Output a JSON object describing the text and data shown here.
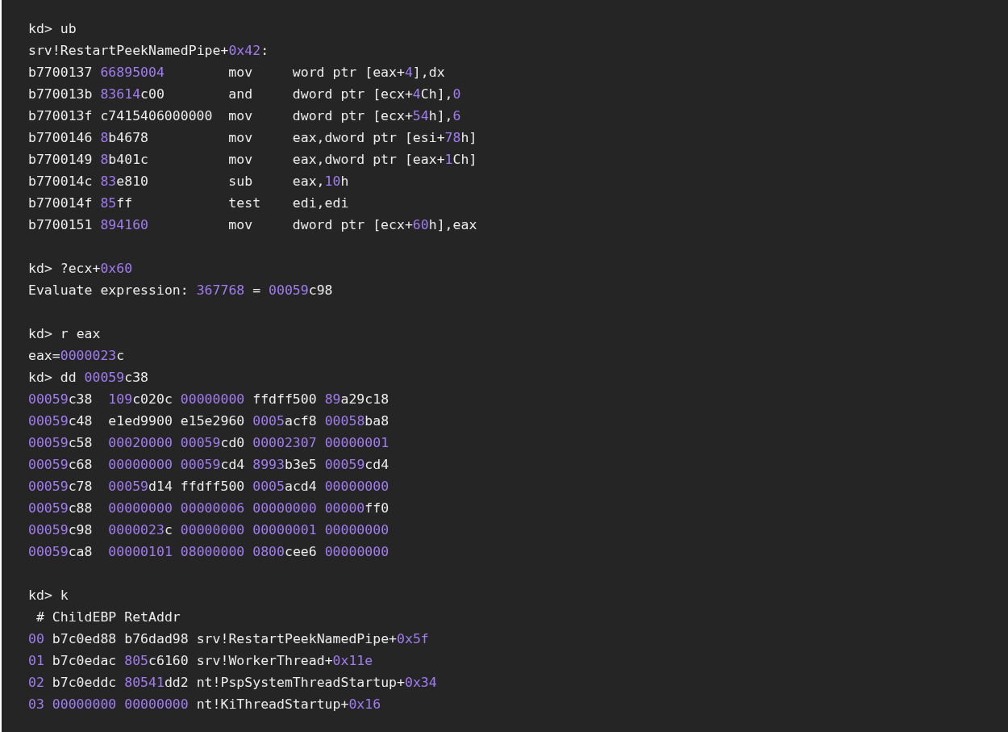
{
  "code_blocks": [
    {
      "lines": [
        "kd> ub",
        "srv!RestartPeekNamedPipe+0x42:"
      ],
      "disassembly": [
        {
          "address": "b7700137",
          "bytes": "66895004",
          "mnemonic": "mov",
          "operands": "word ptr [eax+4],dx"
        },
        {
          "address": "b770013b",
          "bytes": "83614c00",
          "mnemonic": "and",
          "operands": "dword ptr [ecx+4Ch],0"
        },
        {
          "address": "b770013f",
          "bytes": "c7415406000000",
          "mnemonic": "mov",
          "operands": "dword ptr [ecx+54h],6"
        },
        {
          "address": "b7700146",
          "bytes": "8b4678",
          "mnemonic": "mov",
          "operands": "eax,dword ptr [esi+78h]"
        },
        {
          "address": "b7700149",
          "bytes": "8b401c",
          "mnemonic": "mov",
          "operands": "eax,dword ptr [eax+1Ch]"
        },
        {
          "address": "b770014c",
          "bytes": "83e810",
          "mnemonic": "sub",
          "operands": "eax,10h"
        },
        {
          "address": "b770014f",
          "bytes": "85ff",
          "mnemonic": "test",
          "operands": "edi,edi"
        },
        {
          "address": "b7700151",
          "bytes": "894160",
          "mnemonic": "mov",
          "operands": "dword ptr [ecx+60h],eax"
        }
      ]
    },
    {
      "lines": [
        "kd> ?ecx+0x60",
        "Evaluate expression: 367768 = 00059c98"
      ]
    },
    {
      "lines": [
        "kd> r eax",
        "eax=0000023c",
        "kd> dd 00059c38",
        "00059c38  109c020c 00000000 ffdff500 89a29c18",
        "00059c48  e1ed9900 e15e2960 0005acf8 00058ba8",
        "00059c58  00020000 00059cd0 00002307 00000001",
        "00059c68  00000000 00059cd4 8993b3e5 00059cd4",
        "00059c78  00059d14 ffdff500 0005acd4 00000000",
        "00059c88  00000000 00000006 00000000 00000ff0",
        "00059c98  0000023c 00000000 00000001 00000000",
        "00059ca8  00000101 08000000 0800cee6 00000000"
      ]
    },
    {
      "lines": [
        "kd> k",
        " # ChildEBP RetAddr",
        "00 b7c0ed88 b76dad98 srv!RestartPeekNamedPipe+0x5f",
        "01 b7c0edac 805c6160 srv!WorkerThread+0x11e",
        "02 b7c0eddc 80541dd2 nt!PspSystemThreadStartup+0x34",
        "03 00000000 00000000 nt!KiThreadStartup+0x16"
      ]
    }
  ]
}
